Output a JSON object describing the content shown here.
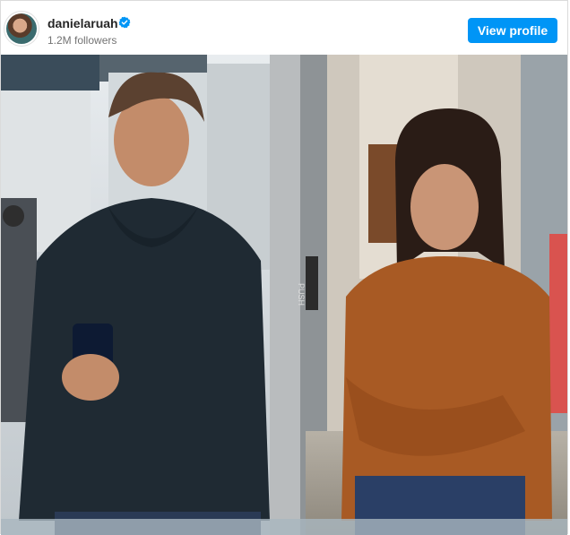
{
  "post": {
    "username": "danielaruah",
    "verified": true,
    "followers": "1.2M followers",
    "view_profile_label": "View profile"
  },
  "photo": {
    "door_sign": "PUSH"
  },
  "icons": {
    "avatar": "profile-photo",
    "verified": "verified-badge-icon"
  },
  "colors": {
    "button": "#0095f6",
    "verified": "#0095f6",
    "username": "#262626",
    "followers": "#737373"
  }
}
